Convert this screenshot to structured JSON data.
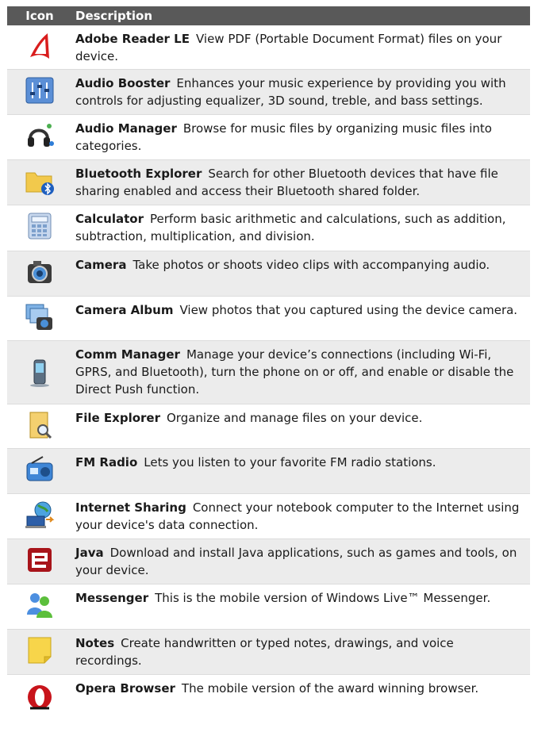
{
  "header": {
    "icon_label": "Icon",
    "description_label": "Description"
  },
  "rows": [
    {
      "name": "Adobe Reader LE",
      "desc": "View PDF (Portable Document Format) files on your device.",
      "icon": "adobe-reader-icon"
    },
    {
      "name": "Audio Booster",
      "desc": "Enhances your music experience by providing you with controls for adjusting equalizer, 3D sound, treble, and bass settings.",
      "icon": "equalizer-icon"
    },
    {
      "name": "Audio Manager",
      "desc": "Browse for music files by organizing music files into categories.",
      "icon": "headphones-icon"
    },
    {
      "name": "Bluetooth Explorer",
      "desc": "Search for other Bluetooth devices that have file sharing enabled and access their Bluetooth shared folder.",
      "icon": "bluetooth-folder-icon"
    },
    {
      "name": "Calculator",
      "desc": "Perform basic arithmetic and calculations, such as addition, subtraction, multiplication, and division.",
      "icon": "calculator-icon"
    },
    {
      "name": "Camera",
      "desc": "Take photos or shoots video clips with accompanying audio.",
      "icon": "camera-icon"
    },
    {
      "name": "Camera Album",
      "desc": "View photos that you captured using the device camera.",
      "icon": "camera-album-icon"
    },
    {
      "name": "Comm Manager",
      "desc": "Manage your device’s connections (including Wi-Fi, GPRS, and Bluetooth), turn the phone on or off, and enable or disable the Direct Push function.",
      "icon": "phone-device-icon"
    },
    {
      "name": "File Explorer",
      "desc": "Organize and manage files on your device.",
      "icon": "folder-search-icon"
    },
    {
      "name": "FM Radio",
      "desc": "Lets you listen to your favorite FM radio stations.",
      "icon": "radio-icon"
    },
    {
      "name": "Internet Sharing",
      "desc": "Connect your notebook computer to the Internet using your device's data connection.",
      "icon": "internet-sharing-icon"
    },
    {
      "name": "Java",
      "desc": "Download and install Java applications, such as games and tools, on your device.",
      "icon": "java-e-icon"
    },
    {
      "name": "Messenger",
      "desc": "This is the mobile version of Windows Live™ Messenger.",
      "icon": "messenger-buddies-icon"
    },
    {
      "name": "Notes",
      "desc": "Create handwritten or typed notes, drawings, and voice recordings.",
      "icon": "sticky-note-icon"
    },
    {
      "name": "Opera Browser",
      "desc": "The mobile version of the award winning browser.",
      "icon": "opera-browser-icon"
    }
  ]
}
